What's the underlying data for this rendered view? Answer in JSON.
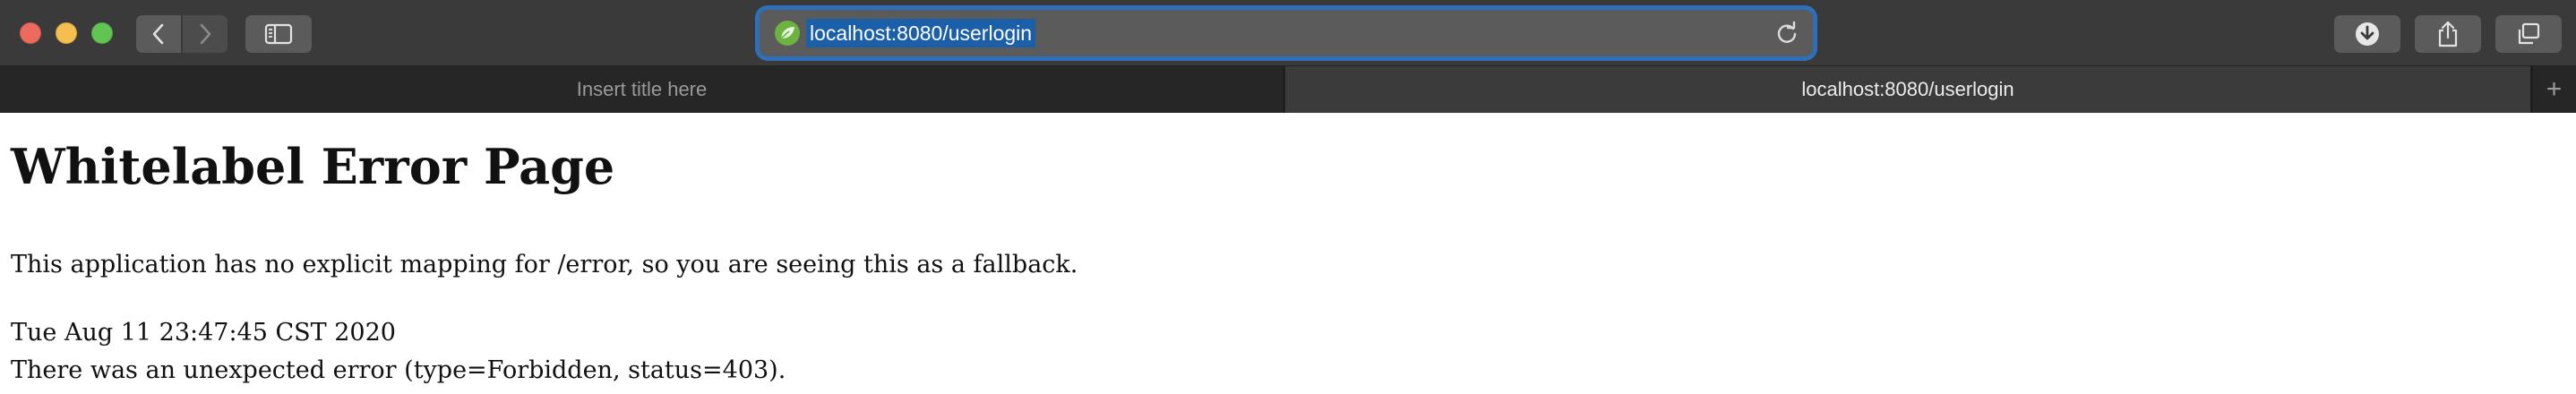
{
  "browser": {
    "url": "localhost:8080/userlogin",
    "colors": {
      "toolbar": "#3a3a3a",
      "focus_ring": "#2d6fb8",
      "url_selection": "#1b5fa8"
    },
    "icons": {
      "site": "spring-leaf-icon",
      "back": "chevron-left-icon",
      "forward": "chevron-right-icon",
      "sidebar": "sidebar-icon",
      "reload": "reload-icon",
      "download": "download-icon",
      "share": "share-icon",
      "tabs": "tab-overview-icon"
    }
  },
  "tabs": [
    {
      "label": "Insert title here",
      "active": false
    },
    {
      "label": "localhost:8080/userlogin",
      "active": true
    }
  ],
  "tab_add_label": "+",
  "page": {
    "title": "Whitelabel Error Page",
    "message": "This application has no explicit mapping for /error, so you are seeing this as a fallback.",
    "timestamp": "Tue Aug 11 23:47:45 CST 2020",
    "error": "There was an unexpected error (type=Forbidden, status=403)."
  }
}
